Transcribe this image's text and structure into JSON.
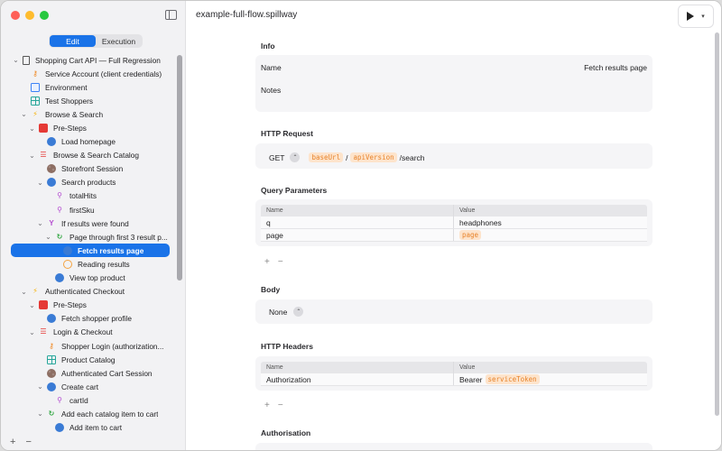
{
  "window": {
    "title": "example-full-flow.spillway"
  },
  "sidebar": {
    "mode_tabs": [
      "Edit",
      "Execution"
    ],
    "active_mode": "Edit",
    "tree": [
      {
        "label": "Shopping Cart API — Full Regression",
        "depth": 0,
        "expanded": true,
        "icon": "document-icon"
      },
      {
        "label": "Service Account (client credentials)",
        "depth": 1,
        "icon": "key-icon"
      },
      {
        "label": "Environment",
        "depth": 1,
        "icon": "environment-icon"
      },
      {
        "label": "Test Shoppers",
        "depth": 1,
        "icon": "table-icon"
      },
      {
        "label": "Browse & Search",
        "depth": 1,
        "expanded": true,
        "icon": "bolt-icon"
      },
      {
        "label": "Pre-Steps",
        "depth": 2,
        "expanded": true,
        "icon": "pre-steps-icon"
      },
      {
        "label": "Load homepage",
        "depth": 3,
        "icon": "globe-icon"
      },
      {
        "label": "Browse & Search Catalog",
        "depth": 2,
        "expanded": true,
        "icon": "list-icon"
      },
      {
        "label": "Storefront Session",
        "depth": 3,
        "icon": "cookie-icon"
      },
      {
        "label": "Search products",
        "depth": 3,
        "expanded": true,
        "icon": "globe-icon"
      },
      {
        "label": "totalHits",
        "depth": 4,
        "icon": "magnifier-icon"
      },
      {
        "label": "firstSku",
        "depth": 4,
        "icon": "magnifier-icon"
      },
      {
        "label": "If results were found",
        "depth": 3,
        "expanded": true,
        "icon": "branch-icon"
      },
      {
        "label": "Page through first 3 result p...",
        "depth": 4,
        "expanded": true,
        "icon": "loop-icon"
      },
      {
        "label": "Fetch results page",
        "depth": 5,
        "icon": "globe-icon",
        "selected": true
      },
      {
        "label": "Reading results",
        "depth": 5,
        "icon": "clock-icon"
      },
      {
        "label": "View top product",
        "depth": 4,
        "icon": "globe-icon"
      },
      {
        "label": "Authenticated Checkout",
        "depth": 1,
        "expanded": true,
        "icon": "bolt-icon"
      },
      {
        "label": "Pre-Steps",
        "depth": 2,
        "expanded": true,
        "icon": "pre-steps-icon"
      },
      {
        "label": "Fetch shopper profile",
        "depth": 3,
        "icon": "globe-icon"
      },
      {
        "label": "Login & Checkout",
        "depth": 2,
        "expanded": true,
        "icon": "list-icon"
      },
      {
        "label": "Shopper Login (authorization...",
        "depth": 3,
        "icon": "key-icon"
      },
      {
        "label": "Product Catalog",
        "depth": 3,
        "icon": "table-icon"
      },
      {
        "label": "Authenticated Cart Session",
        "depth": 3,
        "icon": "cookie-icon"
      },
      {
        "label": "Create cart",
        "depth": 3,
        "expanded": true,
        "icon": "globe-icon"
      },
      {
        "label": "cartId",
        "depth": 4,
        "icon": "magnifier-icon"
      },
      {
        "label": "Add each catalog item to cart",
        "depth": 3,
        "expanded": true,
        "icon": "loop-icon"
      },
      {
        "label": "Add item to cart",
        "depth": 4,
        "icon": "globe-icon"
      }
    ],
    "footer": {
      "add": "+",
      "remove": "−"
    }
  },
  "info": {
    "title": "Info",
    "name_label": "Name",
    "name_value": "Fetch results page",
    "notes_label": "Notes"
  },
  "request": {
    "title": "HTTP Request",
    "method": "GET",
    "url_tokens": [
      "baseUrl",
      "apiVersion"
    ],
    "url_sep": "/",
    "url_suffix": "/search"
  },
  "query": {
    "title": "Query Parameters",
    "columns": [
      "Name",
      "Value"
    ],
    "rows": [
      {
        "name": "q",
        "value": "headphones",
        "token": ""
      },
      {
        "name": "page",
        "value": "",
        "token": "page"
      }
    ]
  },
  "body": {
    "title": "Body",
    "value": "None"
  },
  "headers": {
    "title": "HTTP Headers",
    "columns": [
      "Name",
      "Value"
    ],
    "rows": [
      {
        "name": "Authorization",
        "value": "Bearer",
        "token": "serviceToken"
      }
    ]
  },
  "auth": {
    "title": "Authorisation"
  },
  "controls": {
    "add": "+",
    "remove": "−"
  },
  "colors": {
    "accent": "#1a73e8",
    "token_bg": "#fde4cc",
    "token_fg": "#e8832a"
  }
}
